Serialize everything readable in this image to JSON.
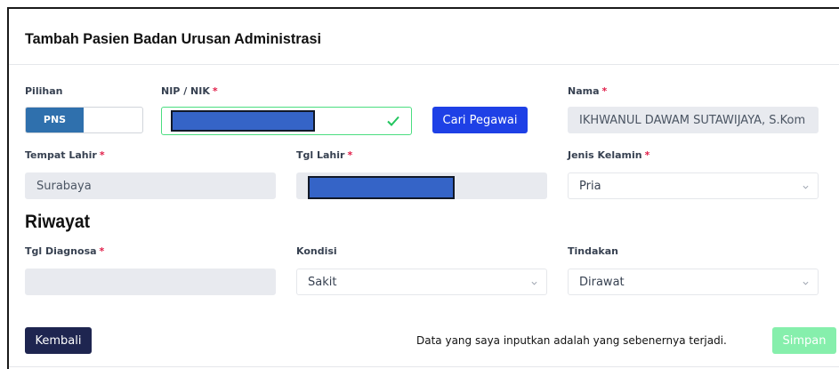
{
  "form": {
    "title": "Tambah Pasien Badan Urusan Administrasi",
    "section_title": "Riwayat",
    "required_mark": "*",
    "pilihan": {
      "label": "Pilihan",
      "selected": "PNS"
    },
    "nip": {
      "label": "NIP / NIK",
      "value_redacted": true
    },
    "search_button": "Cari Pegawai",
    "nama": {
      "label": "Nama",
      "value": "IKHWANUL DAWAM SUTAWIJAYA, S.Kom"
    },
    "tempat_lahir": {
      "label": "Tempat Lahir",
      "value": "Surabaya"
    },
    "tgl_lahir": {
      "label": "Tgl Lahir",
      "value_redacted": true
    },
    "jenis_kelamin": {
      "label": "Jenis Kelamin",
      "value": "Pria"
    },
    "tgl_diagnosa": {
      "label": "Tgl Diagnosa",
      "value": ""
    },
    "kondisi": {
      "label": "Kondisi",
      "value": "Sakit"
    },
    "tindakan": {
      "label": "Tindakan",
      "value": "Dirawat"
    }
  },
  "footer": {
    "back_button": "Kembali",
    "declaration": "Data yang saya inputkan adalah yang sebenernya terjadi.",
    "save_button": "Simpan"
  },
  "colors": {
    "toggle_active": "#2f70ad",
    "primary_button": "#1e40e6",
    "back_button": "#1e2550",
    "save_button": "#86efac",
    "required": "#e11d48",
    "valid_border": "#4ade80"
  },
  "icons": {
    "valid": "check-icon",
    "select": "chevron-down-icon"
  }
}
